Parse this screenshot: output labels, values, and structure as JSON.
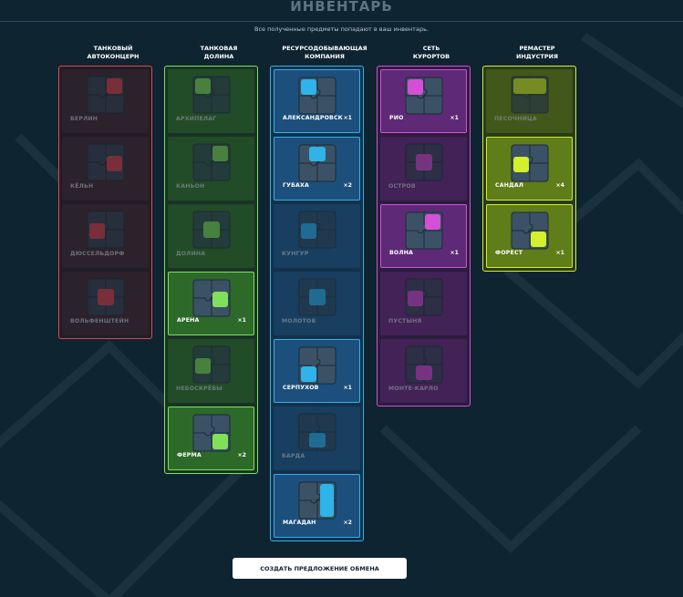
{
  "header": {
    "title": "ИНВЕНТАРЬ",
    "subtitle": "Все полученные предметы попадают в ваш инвентарь."
  },
  "columns": [
    {
      "title": "ТАНКОВЫЙ\nАВТОКОНЦЕРН",
      "accent": "#e0474f",
      "box_bg": "#221c27",
      "tile_bg": "#3a2b33",
      "items": [
        {
          "name": "БЕРЛИН",
          "count": "",
          "owned": false,
          "piece": "top-right"
        },
        {
          "name": "КЁЛЬН",
          "count": "",
          "owned": false,
          "piece": "right"
        },
        {
          "name": "ДЮССЕЛЬДОРФ",
          "count": "",
          "owned": false,
          "piece": "left"
        },
        {
          "name": "ВОЛЬФЕНШТЕЙН",
          "count": "",
          "owned": false,
          "piece": "center"
        }
      ]
    },
    {
      "title": "ТАНКОВАЯ\nДОЛИНА",
      "accent": "#7fe05a",
      "box_bg": "#1a3326",
      "tile_bg": "#2d6a2a",
      "items": [
        {
          "name": "АРХИПЕЛАГ",
          "count": "",
          "owned": false,
          "piece": "top-left"
        },
        {
          "name": "КАНЬОН",
          "count": "",
          "owned": false,
          "piece": "top-right"
        },
        {
          "name": "ДОЛИНА",
          "count": "",
          "owned": false,
          "piece": "center"
        },
        {
          "name": "АРЕНА",
          "count": "×1",
          "owned": true,
          "piece": "right"
        },
        {
          "name": "НЕБОСКРЁБЫ",
          "count": "",
          "owned": false,
          "piece": "left"
        },
        {
          "name": "ФЕРМА",
          "count": "×2",
          "owned": true,
          "piece": "bottom-right"
        }
      ]
    },
    {
      "title": "РЕСУРСОДОБЫВАЮЩАЯ\nКОМПАНИЯ",
      "accent": "#2fb3e8",
      "box_bg": "#14304a",
      "tile_bg": "#1d4f7c",
      "items": [
        {
          "name": "АЛЕКСАНДРОВСК",
          "count": "×1",
          "owned": true,
          "piece": "top-left"
        },
        {
          "name": "ГУБАХА",
          "count": "×2",
          "owned": true,
          "piece": "top-center"
        },
        {
          "name": "КУНГУР",
          "count": "",
          "owned": false,
          "piece": "left"
        },
        {
          "name": "МОЛОТОВ",
          "count": "",
          "owned": false,
          "piece": "center"
        },
        {
          "name": "СЕРПУХОВ",
          "count": "×1",
          "owned": true,
          "piece": "bottom-left"
        },
        {
          "name": "БАРДА",
          "count": "",
          "owned": false,
          "piece": "bottom-center"
        },
        {
          "name": "МАГАДАН",
          "count": "×2",
          "owned": true,
          "piece": "right-tall"
        }
      ]
    },
    {
      "title": "СЕТЬ\nКУРОРТОВ",
      "accent": "#d44fd6",
      "box_bg": "#2b1d3c",
      "tile_bg": "#5e2a78",
      "items": [
        {
          "name": "РИО",
          "count": "×1",
          "owned": true,
          "piece": "top-left"
        },
        {
          "name": "ОСТРОВ",
          "count": "",
          "owned": false,
          "piece": "center"
        },
        {
          "name": "ВОЛНА",
          "count": "×1",
          "owned": true,
          "piece": "top-right"
        },
        {
          "name": "ПУСТЫНЯ",
          "count": "",
          "owned": false,
          "piece": "left"
        },
        {
          "name": "МОНТЕ-КАРЛО",
          "count": "",
          "owned": false,
          "piece": "bottom-center"
        }
      ]
    },
    {
      "title": "РЕМАСТЕР\nИНДУСТРИЯ",
      "accent": "#d2f02c",
      "box_bg": "#2a3a1c",
      "tile_bg": "#5f7d18",
      "items": [
        {
          "name": "ПЕСОЧНИЦА",
          "count": "",
          "owned": false,
          "piece": "top"
        },
        {
          "name": "САНДАЛ",
          "count": "×4",
          "owned": true,
          "piece": "left"
        },
        {
          "name": "ФОРЕСТ",
          "count": "×1",
          "owned": true,
          "piece": "bottom-right"
        }
      ]
    }
  ],
  "footer": {
    "trade_button_label": "СОЗДАТЬ ПРЕДЛОЖЕНИЕ ОБМЕНА"
  }
}
